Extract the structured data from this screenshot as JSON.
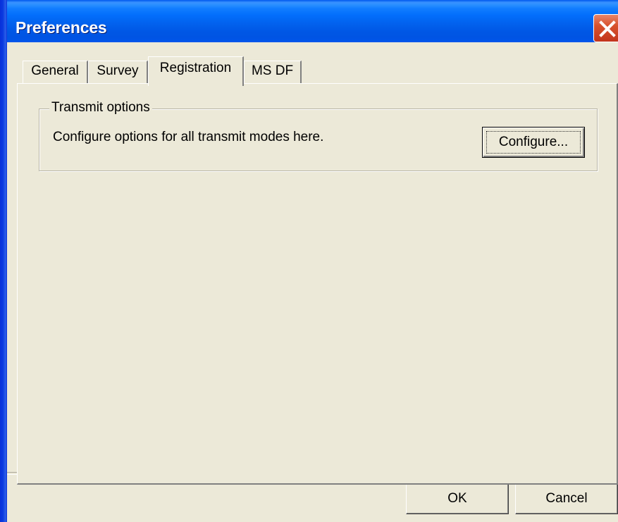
{
  "window": {
    "title": "Preferences"
  },
  "tabs": [
    {
      "label": "General",
      "selected": false
    },
    {
      "label": "Survey",
      "selected": false
    },
    {
      "label": "Registration",
      "selected": true
    },
    {
      "label": "MS DF",
      "selected": false
    }
  ],
  "transmit_group": {
    "label": "Transmit options",
    "description": "Configure options for all transmit modes here.",
    "configure_button": "Configure..."
  },
  "footer": {
    "ok_label": "OK",
    "cancel_label": "Cancel"
  },
  "colors": {
    "titlebar": "#0054e3",
    "dialog_face": "#ece9d8",
    "close_button": "#d8522d"
  },
  "icons": {
    "close": "close-x-icon"
  }
}
